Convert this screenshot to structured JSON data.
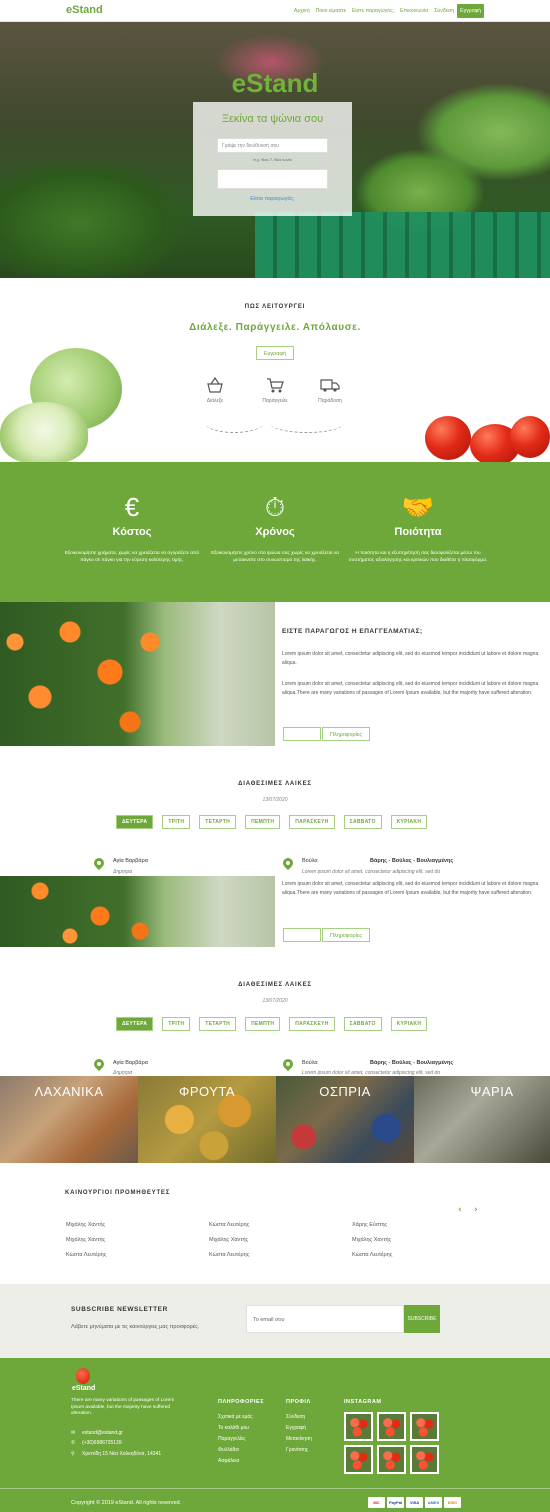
{
  "nav": {
    "logo": "eStand",
    "items": [
      "Αρχική",
      "Ποιοι είμαστε",
      "Είστε παραγωγός;",
      "Επικοινωνία",
      "Σύνδεση"
    ],
    "register": "Εγγραφή"
  },
  "hero": {
    "title": "eStand",
    "subtitle": "Ξεκίνα τα ψώνια σου",
    "address_placeholder": "Γράψε την διεύθυνσή σου",
    "hint": "π.χ. Ναυ 7, Νέα Ιωνία",
    "producer_link": "Είσαι παραγωγός;"
  },
  "how": {
    "heading": "ΠΩΣ ΛΕΙΤΟΥΡΓΕΙ",
    "tagline": "Διάλεξε. Παράγγειλε. Απόλαυσε.",
    "button": "Εγγραφή",
    "steps": [
      "Διάλεξε",
      "Παράγγειλε",
      "Παράδοση"
    ]
  },
  "features": [
    {
      "icon": "€",
      "title": "Κόστος",
      "text": "Εξοικονομήστε χρήματα, χωρίς να χρειάζεται να αγοράζετε από πάγκο σε πάγκο για την εύρεση καλύτερης τιμής."
    },
    {
      "icon": "⏱",
      "title": "Χρόνος",
      "text": "Εξοικονομήστε χρόνο στα ψώνια σας χωρίς να χρειάζεται να μετακινείτε στο συνωστισμό της λαϊκής."
    },
    {
      "icon": "🤝",
      "title": "Ποιότητα",
      "text": "Η ποιότητα και η εξυπηρέτησή σας διασφαλίζεται μέσω του συστήματος αξιολόγησης και κριτικών που διαθέτει η πλατφόρμα."
    }
  ],
  "producer": {
    "title": "ΕΙΣΤΕ ΠΑΡΑΓΩΓΟΣ Η ΕΠΑΓΓΕΛΜΑΤΙΑΣ;",
    "p1": "Lorem ipsum dolor sit amet, consectetur adipiscing elit, sed do eiusmod tempor incididunt ut labore et dolore magna aliqua.",
    "p2": "Lorem ipsum dolor sit amet, consectetur adipiscing elit, sed do eiusmod tempor incididunt ut labore et dolore magna aliqua.There are many variations of passages of Lorem Ipsum available, but the majority have suffered alteration.",
    "button": "Πληροφορίες"
  },
  "markets": {
    "heading": "ΔΙΑΘΕΣΙΜΕΣ ΛΑΙΚΕΣ",
    "date": "13/07/2020",
    "days": [
      "ΔΕΥΤΕΡΑ",
      "ΤΡΙΤΗ",
      "ΤΕΤΑΡΤΗ",
      "ΠΕΜΠΤΗ",
      "ΠΑΡΑΣΚΕΥΗ",
      "ΣΑΒΒΑΤΟ",
      "ΚΥΡΙΑΚΗ"
    ],
    "left_name": "Αγία Βαρβάρα",
    "left_sub": "Δημητρα",
    "right_name": "Βούλα",
    "right_title": "Βάρης - Βούλας - Βουλιαγμένης",
    "right_sub": "Lorem ipsum dolor sit amet, consectetur adipiscing elit, sed do",
    "text": "Lorem ipsum dolor sit amet, consectetur adipiscing elit, sed do eiusmod tempor incididunt ut labore et dolore magna aliqua.There are many variations of passages of Lorem Ipsum available, but the majority have suffered alteration.",
    "button": "Πληροφορίες"
  },
  "categories": [
    "ΛΑΧΑΝΙΚΑ",
    "ΦΡΟΥΤΑ",
    "ΟΣΠΡΙΑ",
    "ΨΑΡΙΑ"
  ],
  "suppliers": {
    "heading": "ΚΑΙΝΟΥΡΓΙΟΙ ΠΡΟΜΗΘΕΥΤΕΣ",
    "col1": [
      "Μιχάλης Χαντής",
      "Μιχάλης Χαντής",
      "Κώστα Λευτέρης"
    ],
    "col2": [
      "Κώστα Λευτέρης",
      "Μιχάλης Χαντής",
      "Κώστα Λευτέρης"
    ],
    "col3": [
      "Χάρης Εύστης",
      "Μιχάλης Χαντής",
      "Κώστα Λευτέρης"
    ]
  },
  "newsletter": {
    "title": "SUBSCRIBE NEWSLETTER",
    "subtitle": "Λάβετε μηνύματα με τις καινούργιες μας προσφορές.",
    "placeholder": "Το email σου",
    "button": "SUBSCRIBE"
  },
  "footer": {
    "logo": "eStand",
    "about": "There are many variations of passages of Lorem Ipsum available, but the majority have suffered alteration.",
    "email": "estand@estand.gr",
    "phone": "(+30)6986725139",
    "address": "Χριστίδη 15 Νέα Χαλκηδόνα, 14341",
    "info_heading": "ΠΛΗΡΟΦΟΡΙΕΣ",
    "info": [
      "Σχετικά με εμάς",
      "Το καλάθι μου",
      "Παραγγελίες",
      "Φυλλάδιο",
      "Ασφάλεια"
    ],
    "profile_heading": "ΠΡΟΦΙΛ",
    "profile": [
      "Σύνδεση",
      "Εγγραφή",
      "Μετακίνηση",
      "Γρανίτσης"
    ],
    "instagram_heading": "INSTAGRAM",
    "copyright": "Copyright © 2019 eStand. All rights reserved.",
    "payments": [
      "MC",
      "PayPal",
      "VISA",
      "AMEX",
      "DISC"
    ]
  },
  "colors": {
    "accent": "#6fa83a"
  }
}
